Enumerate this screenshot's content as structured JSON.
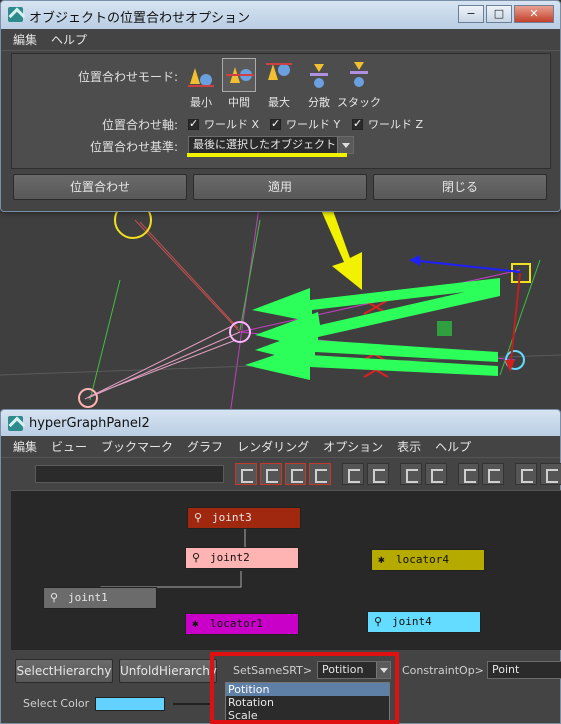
{
  "align_window": {
    "title": "オブジェクトの位置合わせオプション",
    "menu": [
      "編集",
      "ヘルプ"
    ],
    "window_controls": [
      "−",
      "□",
      "✕"
    ],
    "mode_label": "位置合わせモード:",
    "modes": [
      {
        "label": "最小",
        "icon": "align-min-icon"
      },
      {
        "label": "中間",
        "icon": "align-mid-icon",
        "selected": true
      },
      {
        "label": "最大",
        "icon": "align-max-icon"
      },
      {
        "label": "分散",
        "icon": "distribute-icon"
      },
      {
        "label": "スタック",
        "icon": "stack-icon"
      }
    ],
    "axis_label": "位置合わせ軸:",
    "axes": [
      {
        "label": "ワールド X",
        "checked": true
      },
      {
        "label": "ワールド Y",
        "checked": true
      },
      {
        "label": "ワールド Z",
        "checked": true
      }
    ],
    "basis_label": "位置合わせ基準:",
    "basis_value": "最後に選択したオブジェクト",
    "buttons": {
      "align": "位置合わせ",
      "apply": "適用",
      "close": "閉じる"
    }
  },
  "hypergraph": {
    "title": "hyperGraphPanel2",
    "menu": [
      "編集",
      "ビュー",
      "ブックマーク",
      "グラフ",
      "レンダリング",
      "オプション",
      "表示",
      "ヘルプ"
    ],
    "nodes": [
      {
        "name": "joint3",
        "color": "#a0280f",
        "text_color": "#e6e6e6",
        "icon": "joint-icon"
      },
      {
        "name": "joint2",
        "color": "#ffb4b4",
        "text_color": "#111111",
        "icon": "joint-icon"
      },
      {
        "name": "joint1",
        "color": "#6b6b6b",
        "text_color": "#e6e6e6",
        "icon": "joint-icon"
      },
      {
        "name": "locator4",
        "color": "#b4aa00",
        "text_color": "#111111",
        "icon": "locator-icon"
      },
      {
        "name": "locator1",
        "color": "#c800c8",
        "text_color": "#111111",
        "icon": "locator-icon"
      },
      {
        "name": "joint4",
        "color": "#64dcff",
        "text_color": "#111111",
        "icon": "joint-icon"
      }
    ],
    "buttons": {
      "select_hierarchy": "SelectHierarchy",
      "unfold_hierarchy": "UnfoldHierarchy"
    },
    "set_same_srt_label": "SetSameSRT>",
    "set_same_srt_value": "Potition",
    "constraint_label": "ConstraintOp>",
    "constraint_value": "Point",
    "select_color_label": "Select Color",
    "select_color": "#64d2ff",
    "popup_options": [
      "Potition",
      "Rotation",
      "Scale"
    ],
    "popup_selected": "Potition"
  },
  "colors": {
    "highlight_yellow": "#f2f200",
    "arrow_green": "#2cff5a",
    "frame_red": "#e01010"
  }
}
